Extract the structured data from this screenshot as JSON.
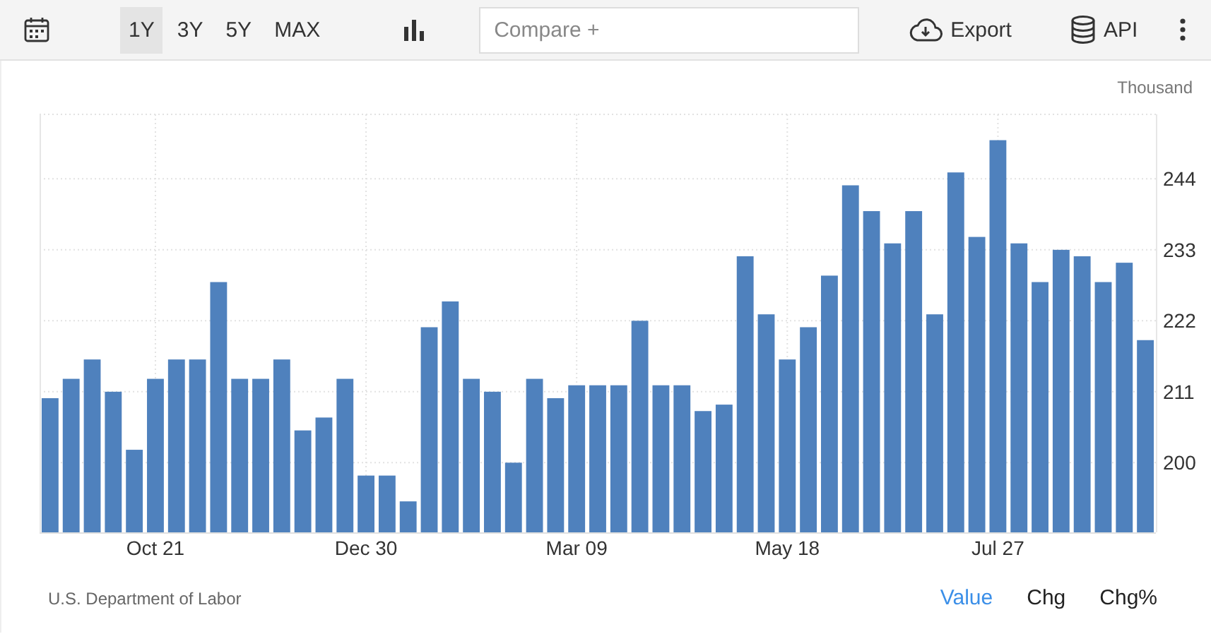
{
  "toolbar": {
    "periods": [
      {
        "label": "1Y",
        "selected": true
      },
      {
        "label": "3Y",
        "selected": false
      },
      {
        "label": "5Y",
        "selected": false
      },
      {
        "label": "MAX",
        "selected": false
      }
    ],
    "compare": {
      "placeholder": "Compare +"
    },
    "actions": [
      {
        "label": "Export",
        "kind": "export"
      },
      {
        "label": "API",
        "kind": "api"
      }
    ]
  },
  "chart": {
    "unit": "Thousand",
    "chart_data": {
      "type": "bar",
      "grid": true,
      "ylim": [
        189.2,
        254
      ],
      "yticks": [
        200,
        211,
        222,
        233,
        244
      ],
      "categories": [
        null,
        null,
        null,
        null,
        null,
        "Oct 21",
        null,
        null,
        null,
        null,
        null,
        null,
        null,
        null,
        null,
        "Dec 30",
        null,
        null,
        null,
        null,
        null,
        null,
        null,
        null,
        null,
        "Mar 09",
        null,
        null,
        null,
        null,
        null,
        null,
        null,
        null,
        null,
        "May 18",
        null,
        null,
        null,
        null,
        null,
        null,
        null,
        null,
        null,
        "Jul 27",
        null,
        null,
        null,
        null,
        null,
        null,
        null
      ],
      "series": [
        {
          "color": "#4f81bd",
          "values": [
            210,
            213,
            216,
            211,
            202,
            213,
            216,
            216,
            228,
            213,
            213,
            216,
            205,
            207,
            213,
            198,
            198,
            194,
            221,
            225,
            213,
            211,
            200,
            213,
            210,
            212,
            212,
            212,
            222,
            212,
            212,
            208,
            209,
            232,
            223,
            216,
            221,
            229,
            243,
            239,
            234,
            239,
            223,
            245,
            235,
            250,
            234,
            228,
            233,
            232,
            228,
            231,
            219
          ]
        }
      ]
    }
  },
  "footer": {
    "source": "U.S. Department of Labor",
    "modes": [
      {
        "label": "Value",
        "selected": true
      },
      {
        "label": "Chg",
        "selected": false
      },
      {
        "label": "Chg%",
        "selected": false
      }
    ]
  }
}
